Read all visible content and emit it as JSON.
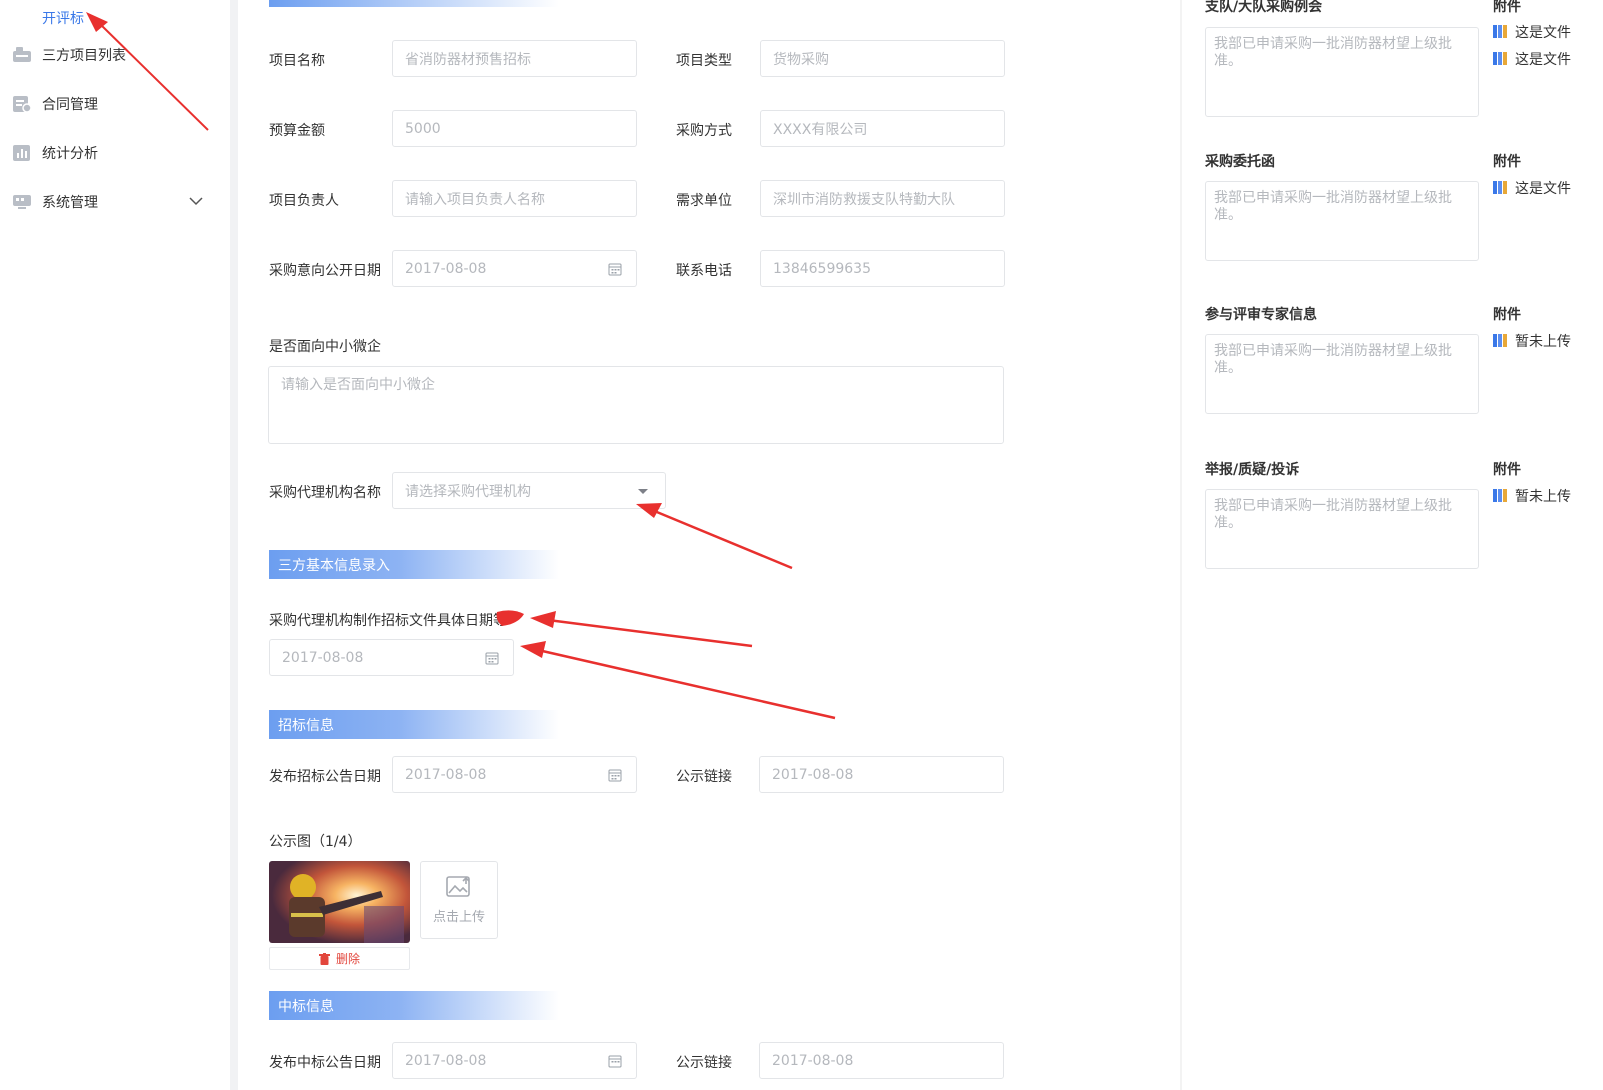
{
  "sidebar": {
    "sub_item": "开评标",
    "items": [
      {
        "label": "三方项目列表",
        "icon": "project-list-icon"
      },
      {
        "label": "合同管理",
        "icon": "contract-icon"
      },
      {
        "label": "统计分析",
        "icon": "chart-icon"
      },
      {
        "label": "系统管理",
        "icon": "system-icon"
      }
    ]
  },
  "form": {
    "project_name": {
      "label": "项目名称",
      "value": "省消防器材预售招标"
    },
    "project_type": {
      "label": "项目类型",
      "value": "货物采购"
    },
    "budget": {
      "label": "预算金额",
      "value": "5000"
    },
    "purchase_method": {
      "label": "采购方式",
      "value": "XXXX有限公司"
    },
    "project_leader": {
      "label": "项目负责人",
      "placeholder": "请输入项目负责人名称"
    },
    "demand_unit": {
      "label": "需求单位",
      "value": "深圳市消防救援支队特勤大队"
    },
    "intent_date": {
      "label": "采购意向公开日期",
      "value": "2017-08-08"
    },
    "phone": {
      "label": "联系电话",
      "value": "13846599635"
    },
    "sme": {
      "label": "是否面向中小微企",
      "placeholder": "请输入是否面向中小微企"
    },
    "agency": {
      "label": "采购代理机构名称",
      "placeholder": "请选择采购代理机构"
    }
  },
  "sections": {
    "basic": "三方基本信息录入",
    "bidding": "招标信息",
    "winning": "中标信息"
  },
  "basic_info": {
    "doc_date_label": "采购代理机构制作招标文件具体日期等",
    "doc_date_value": "2017-08-08"
  },
  "bidding": {
    "notice_date_label": "发布招标公告日期",
    "notice_date_value": "2017-08-08",
    "link_label": "公示链接",
    "link_value": "2017-08-08",
    "images_label": "公示图（1/4）",
    "upload_label": "点击上传",
    "delete_label": "删除"
  },
  "winning": {
    "notice_date_label": "发布中标公告日期",
    "notice_date_value": "2017-08-08",
    "link_label": "公示链接",
    "link_value": "2017-08-08"
  },
  "right_panel": {
    "blocks": [
      {
        "label": "支队/大队采购例会",
        "text": "我部已申请采购一批消防器材望上级批准。"
      },
      {
        "label": "采购委托函",
        "text": "我部已申请采购一批消防器材望上级批准。"
      },
      {
        "label": "参与评审专家信息",
        "text": "我部已申请采购一批消防器材望上级批准。"
      },
      {
        "label": "举报/质疑/投诉",
        "text": "我部已申请采购一批消防器材望上级批准。"
      }
    ],
    "attachment_label": "附件",
    "att_file": "这是文件",
    "att_none": "暂未上传"
  },
  "colors": {
    "accent": "#3a78e8",
    "arrow": "#e8302e",
    "section": "#6c9ef0"
  }
}
